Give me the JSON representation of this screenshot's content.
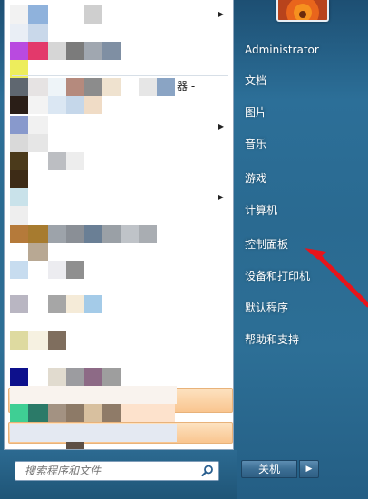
{
  "left_pane": {
    "partial_text": "器 -",
    "submenu_arrow": "▶"
  },
  "search": {
    "placeholder": "搜索程序和文件",
    "icon": "magnifier-icon"
  },
  "right_pane": {
    "user_name": "Administrator",
    "items": [
      {
        "label": "文档"
      },
      {
        "label": "图片"
      },
      {
        "label": "音乐"
      },
      {
        "label": "游戏"
      },
      {
        "label": "计算机"
      },
      {
        "label": "控制面板"
      },
      {
        "label": "设备和打印机"
      },
      {
        "label": "默认程序"
      },
      {
        "label": "帮助和支持"
      }
    ]
  },
  "shutdown": {
    "label": "关机",
    "arrow": "▶"
  },
  "colors": {
    "annotation_arrow": "#e8141b",
    "highlight": "#f9c58f",
    "panel_blue": "#2a6a91"
  }
}
